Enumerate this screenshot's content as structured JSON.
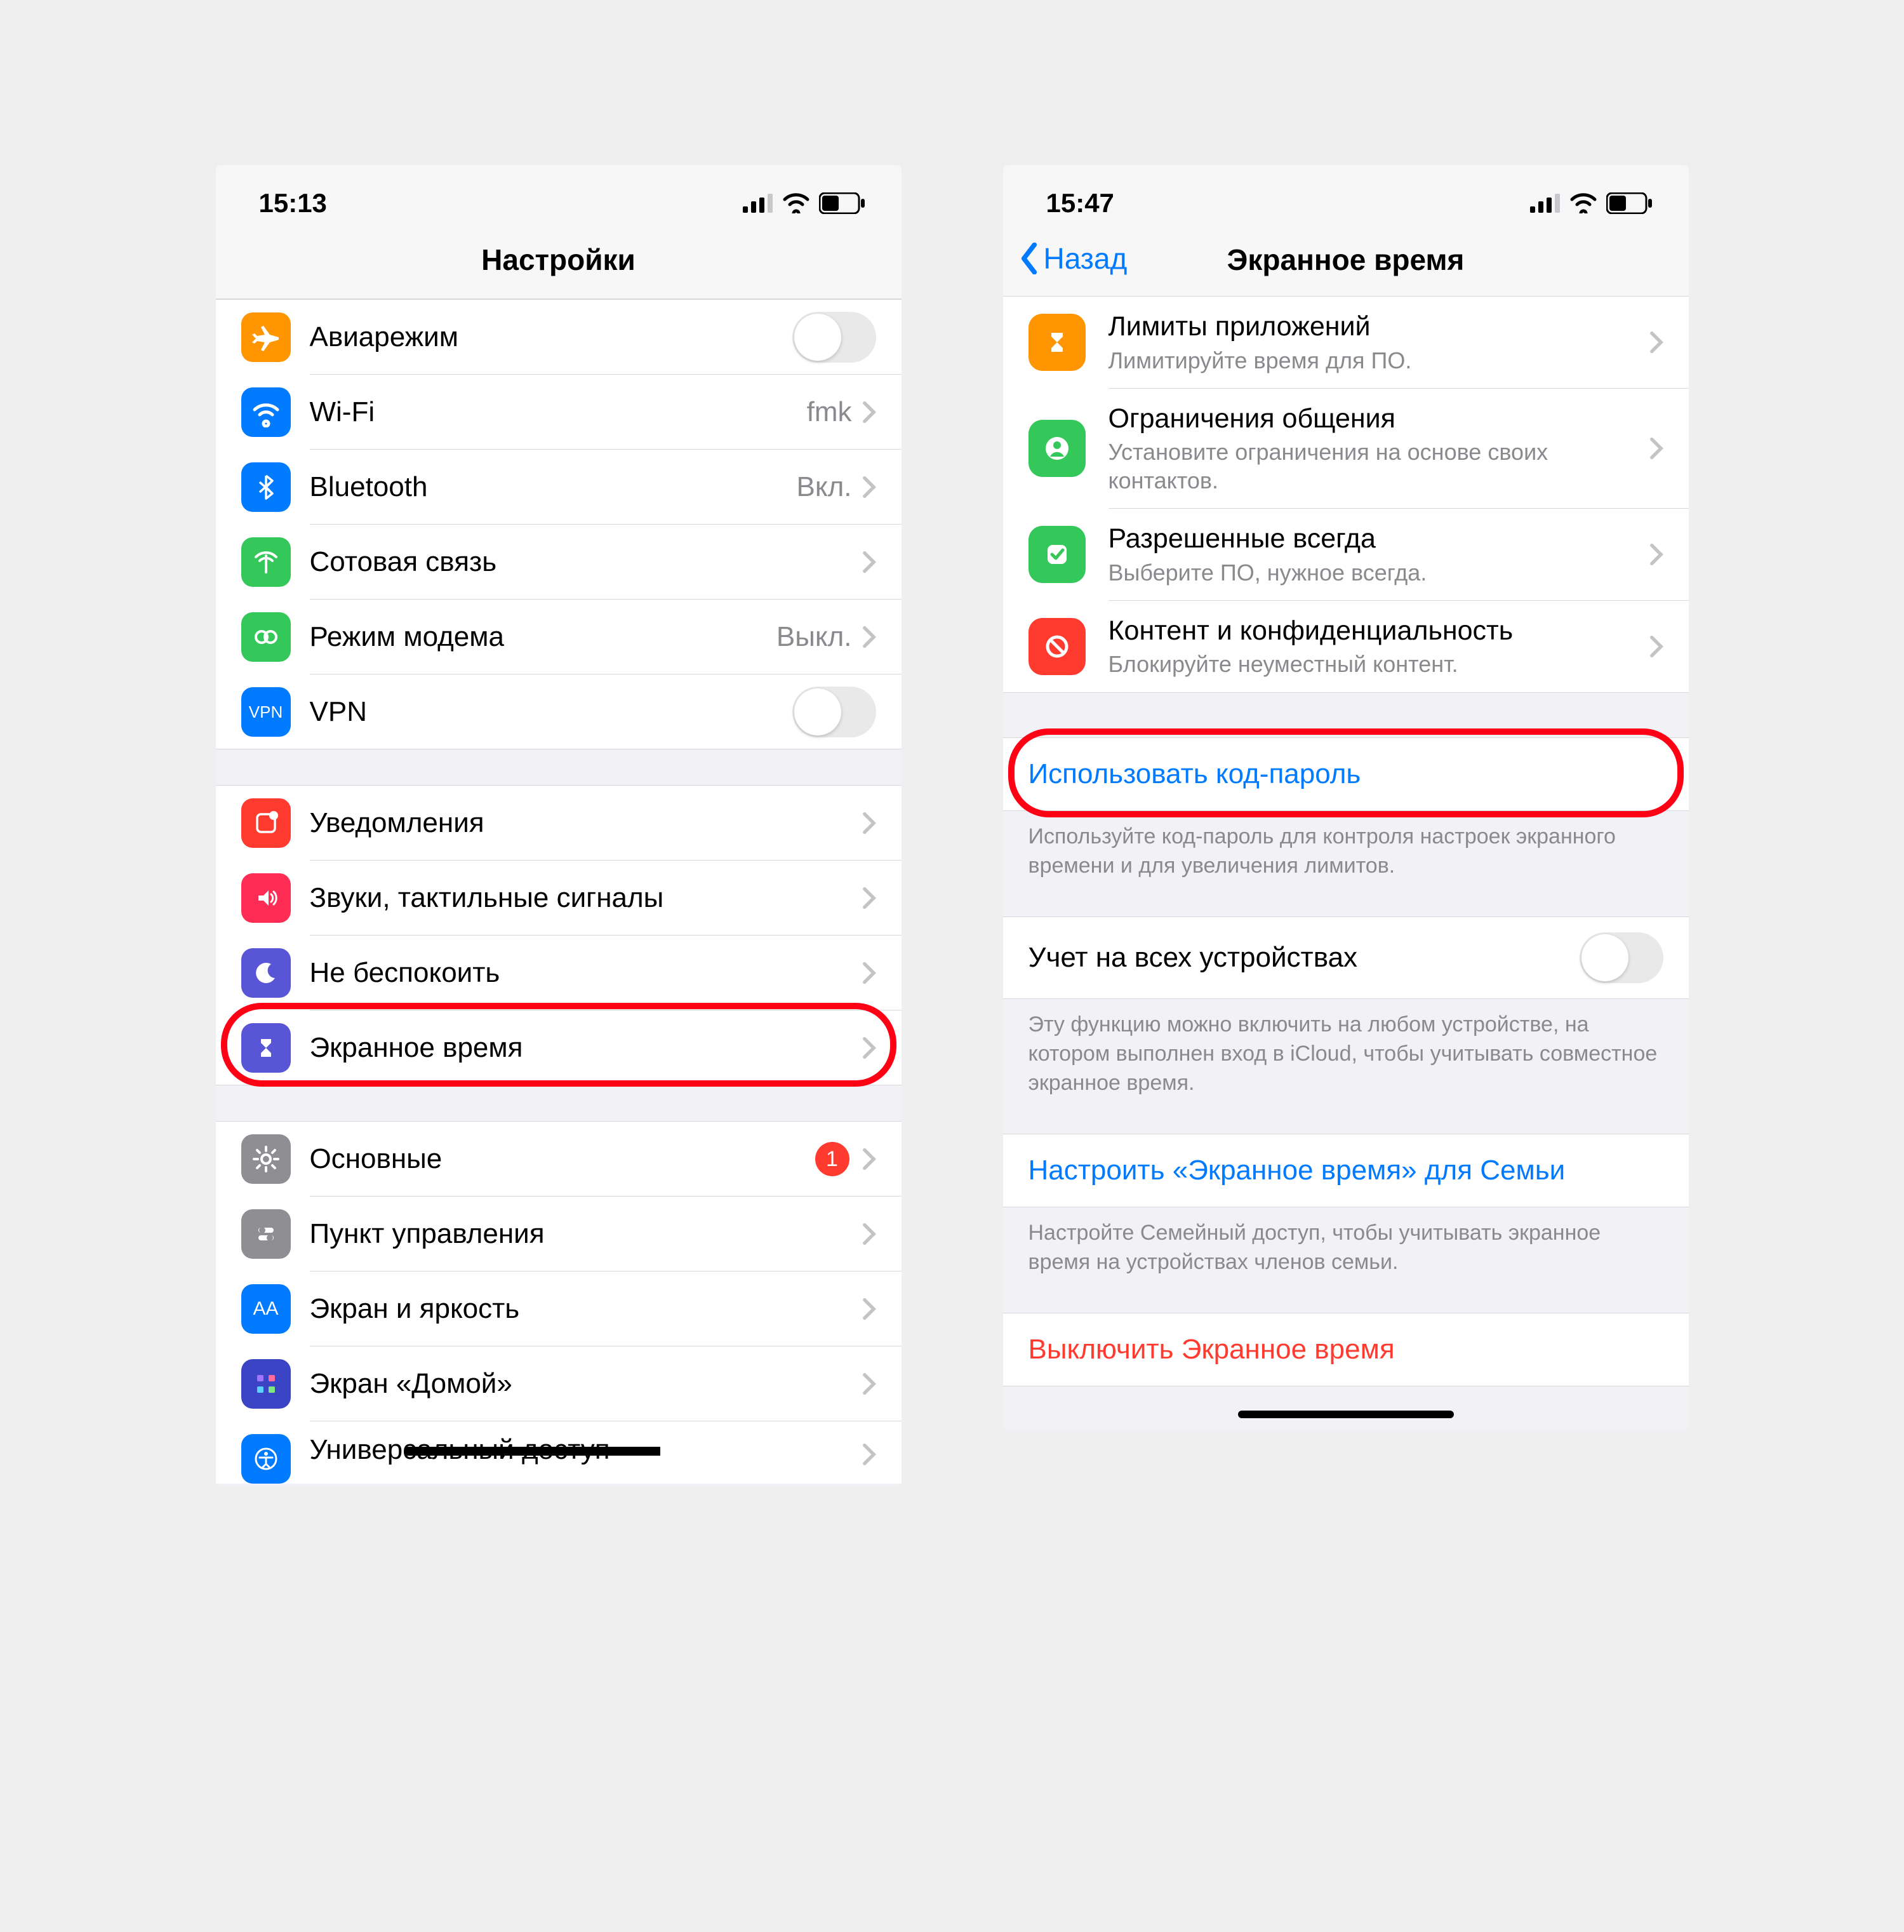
{
  "left": {
    "status_time": "15:13",
    "header_title": "Настройки",
    "groups": [
      [
        {
          "key": "airplane",
          "icon_bg": "#ff9500",
          "label": "Авиарежим",
          "toggle": true
        },
        {
          "key": "wifi",
          "icon_bg": "#007aff",
          "label": "Wi-Fi",
          "value": "fmk",
          "chevron": true
        },
        {
          "key": "bluetooth",
          "icon_bg": "#007aff",
          "label": "Bluetooth",
          "value": "Вкл.",
          "chevron": true
        },
        {
          "key": "cellular",
          "icon_bg": "#34c759",
          "label": "Сотовая связь",
          "chevron": true
        },
        {
          "key": "hotspot",
          "icon_bg": "#34c759",
          "label": "Режим модема",
          "value": "Выкл.",
          "chevron": true
        },
        {
          "key": "vpn",
          "icon_bg": "#007aff",
          "icon_text": "VPN",
          "label": "VPN",
          "toggle": true
        }
      ],
      [
        {
          "key": "notifications",
          "icon_bg": "#ff3b30",
          "label": "Уведомления",
          "chevron": true
        },
        {
          "key": "sounds",
          "icon_bg": "#ff2d55",
          "label": "Звуки, тактильные сигналы",
          "chevron": true
        },
        {
          "key": "dnd",
          "icon_bg": "#5856d6",
          "label": "Не беспокоить",
          "chevron": true
        },
        {
          "key": "screentime",
          "icon_bg": "#5856d6",
          "label": "Экранное время",
          "chevron": true,
          "highlighted": true
        }
      ],
      [
        {
          "key": "general",
          "icon_bg": "#8e8e93",
          "label": "Основные",
          "badge": "1",
          "chevron": true
        },
        {
          "key": "control",
          "icon_bg": "#8e8e93",
          "label": "Пункт управления",
          "chevron": true
        },
        {
          "key": "display",
          "icon_bg": "#007aff",
          "icon_text": "AA",
          "label": "Экран и яркость",
          "chevron": true
        },
        {
          "key": "home",
          "icon_bg": "#3a44c5",
          "label": "Экран «Домой»",
          "chevron": true
        },
        {
          "key": "accessibility",
          "icon_bg": "#007aff",
          "label": "Универсальный доступ",
          "chevron": true,
          "redacted": true
        }
      ]
    ]
  },
  "right": {
    "status_time": "15:47",
    "back_label": "Назад",
    "header_title": "Экранное время",
    "items": [
      {
        "key": "applimits",
        "icon_bg": "#ff9500",
        "title": "Лимиты приложений",
        "sub": "Лимитируйте время для ПО."
      },
      {
        "key": "comm",
        "icon_bg": "#34c759",
        "title": "Ограничения общения",
        "sub": "Установите ограничения на основе своих контактов."
      },
      {
        "key": "allowed",
        "icon_bg": "#34c759",
        "title": "Разрешенные всегда",
        "sub": "Выберите ПО, нужное всегда."
      },
      {
        "key": "content",
        "icon_bg": "#ff3b30",
        "title": "Контент и конфиденциальность",
        "sub": "Блокируйте неуместный контент."
      }
    ],
    "passcode_link": "Использовать код-пароль",
    "passcode_footer": "Используйте код-пароль для контроля настроек экранного времени и для увеличения лимитов.",
    "share_label": "Учет на всех устройствах",
    "share_footer": "Эту функцию можно включить на любом устройстве, на котором выполнен вход в iCloud, чтобы учитывать совместное экранное время.",
    "family_link": "Настроить «Экранное время» для Семьи",
    "family_footer": "Настройте Семейный доступ, чтобы учитывать экранное время на устройствах членов семьи.",
    "disable_link": "Выключить Экранное время"
  }
}
